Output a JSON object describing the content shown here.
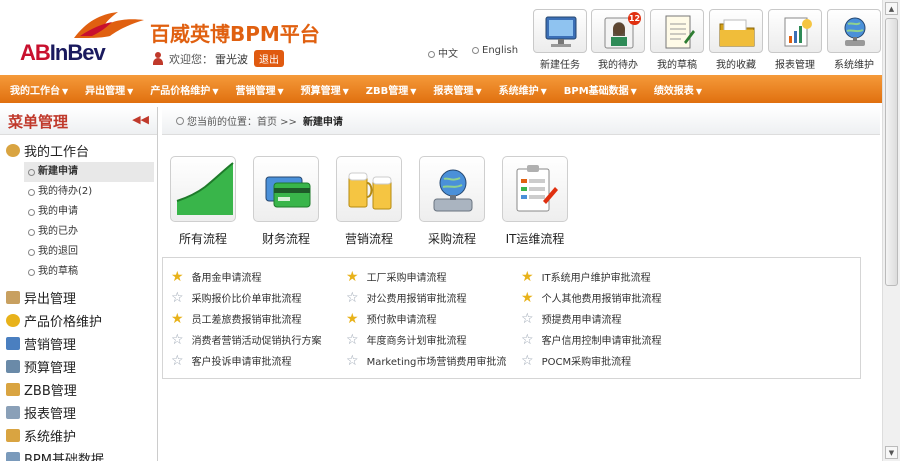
{
  "header": {
    "logo_ab": "AB",
    "logo_inbev": "InBev",
    "platform_title": "百威英博BPM平台",
    "welcome_label": "欢迎您：",
    "user_name": "雷光波",
    "logout_label": "退出",
    "lang_zh": "中文",
    "lang_en": "English",
    "quick_links": [
      {
        "label": "新建任务",
        "icon": "monitor-icon"
      },
      {
        "label": "我的待办",
        "icon": "todo-portrait-icon",
        "badge": "12"
      },
      {
        "label": "我的草稿",
        "icon": "draft-notepad-icon"
      },
      {
        "label": "我的收藏",
        "icon": "favorites-folder-icon"
      },
      {
        "label": "报表管理",
        "icon": "report-icon"
      },
      {
        "label": "系统维护",
        "icon": "system-globe-icon"
      }
    ]
  },
  "nav": {
    "items": [
      "我的工作台",
      "异出管理",
      "产品价格维护",
      "营销管理",
      "预算管理",
      "ZBB管理",
      "报表管理",
      "系统维护",
      "BPM基础数据",
      "绩效报表"
    ]
  },
  "sidebar": {
    "title": "菜单管理",
    "collapse": "◀◀",
    "workbench_label": "我的工作台",
    "sub_items": [
      "新建申请",
      "我的待办(2)",
      "我的申请",
      "我的已办",
      "我的退回",
      "我的草稿"
    ],
    "sections": [
      "异出管理",
      "产品价格维护",
      "营销管理",
      "预算管理",
      "ZBB管理",
      "报表管理",
      "系统维护",
      "BPM基础数据"
    ]
  },
  "breadcrumb": {
    "prefix": "您当前的位置：首页  >>",
    "current": "新建申请"
  },
  "categories": [
    {
      "label": "所有流程",
      "icon": "all-processes-chart-icon"
    },
    {
      "label": "财务流程",
      "icon": "finance-cards-icon"
    },
    {
      "label": "营销流程",
      "icon": "marketing-beer-icon"
    },
    {
      "label": "采购流程",
      "icon": "procurement-disk-icon"
    },
    {
      "label": "IT运维流程",
      "icon": "it-ops-clipboard-icon"
    }
  ],
  "flows": [
    {
      "label": "备用金申请流程",
      "starred": true
    },
    {
      "label": "工厂采购申请流程",
      "starred": true
    },
    {
      "label": "IT系统用户维护审批流程",
      "starred": true
    },
    {
      "label": "采购报价比价单审批流程",
      "starred": false
    },
    {
      "label": "对公费用报销审批流程",
      "starred": false
    },
    {
      "label": "个人其他费用报销审批流程",
      "starred": true
    },
    {
      "label": "员工差旅费报销审批流程",
      "starred": true
    },
    {
      "label": "预付款申请流程",
      "starred": true
    },
    {
      "label": "预提费用申请流程",
      "starred": false
    },
    {
      "label": "消费者营销活动促销执行方案",
      "starred": false
    },
    {
      "label": "年度商务计划审批流程",
      "starred": false
    },
    {
      "label": "客户信用控制申请审批流程",
      "starred": false
    },
    {
      "label": "客户投诉申请审批流程",
      "starred": false
    },
    {
      "label": "Marketing市场营销费用审批流",
      "starred": false
    },
    {
      "label": "POCM采购审批流程",
      "starred": false
    }
  ]
}
